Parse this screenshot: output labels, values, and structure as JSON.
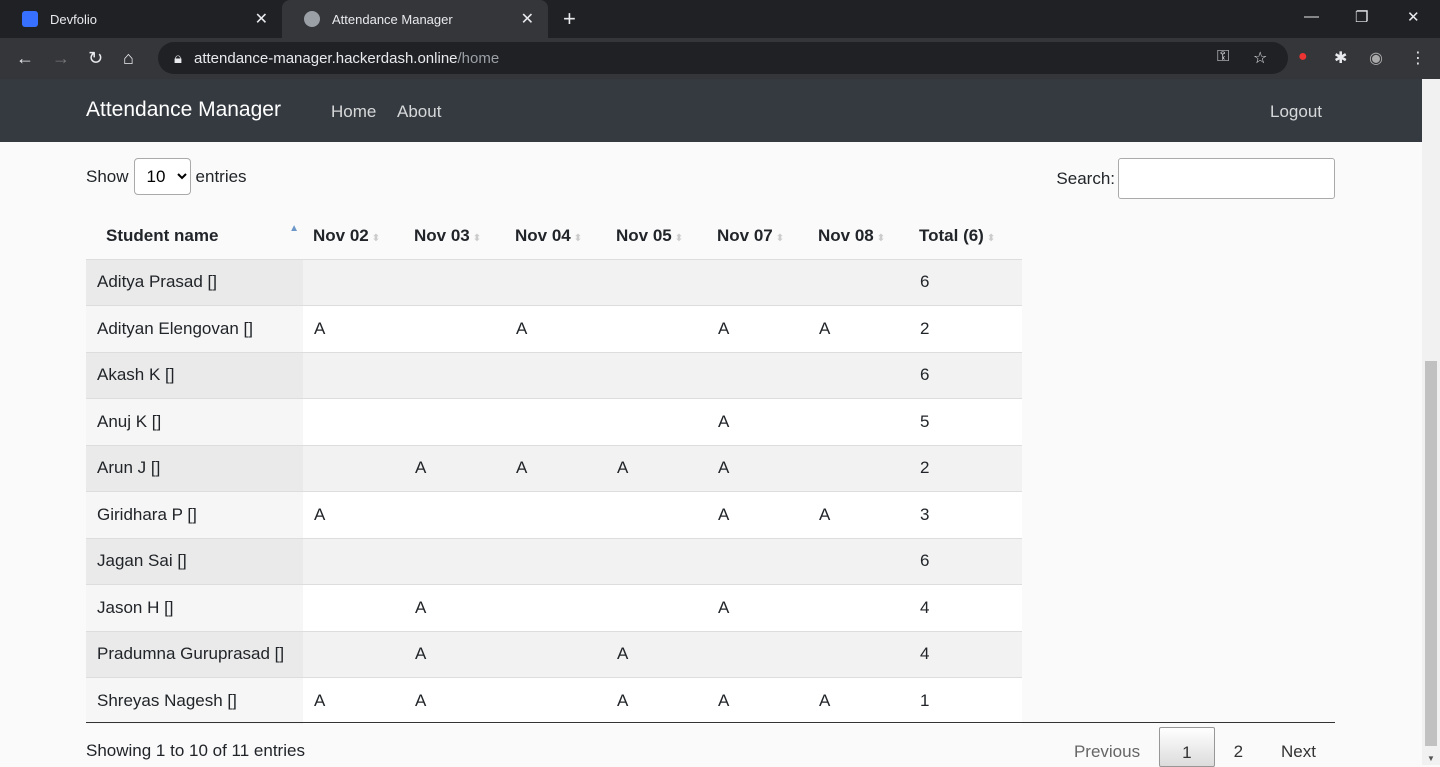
{
  "browser": {
    "tabs": [
      {
        "title": "Devfolio",
        "favicon": "devfolio-logo",
        "favicon_color": "#3770ff"
      },
      {
        "title": "Attendance Manager",
        "favicon": "globe-icon",
        "active": true
      }
    ],
    "url_host": "attendance-manager.hackerdash.online",
    "url_path": "/home"
  },
  "navbar": {
    "brand": "Attendance Manager",
    "links": [
      "Home",
      "About"
    ],
    "logout": "Logout"
  },
  "controls": {
    "show": "Show",
    "entries_value": "10",
    "entries": "entries",
    "search_label": "Search:",
    "search_value": ""
  },
  "table": {
    "headers": [
      "Student name",
      "Nov 02",
      "Nov 03",
      "Nov 04",
      "Nov 05",
      "Nov 07",
      "Nov 08",
      "Total (6)"
    ],
    "sort_column": "Student name",
    "sort_direction": "ascending",
    "rows": [
      [
        "Aditya Prasad []",
        "",
        "",
        "",
        "",
        "",
        "",
        "6"
      ],
      [
        "Adityan Elengovan []",
        "A",
        "",
        "A",
        "",
        "A",
        "A",
        "2"
      ],
      [
        "Akash K []",
        "",
        "",
        "",
        "",
        "",
        "",
        "6"
      ],
      [
        "Anuj K []",
        "",
        "",
        "",
        "",
        "A",
        "",
        "5"
      ],
      [
        "Arun J []",
        "",
        "A",
        "A",
        "A",
        "A",
        "",
        "2"
      ],
      [
        "Giridhara P []",
        "A",
        "",
        "",
        "",
        "A",
        "A",
        "3"
      ],
      [
        "Jagan Sai []",
        "",
        "",
        "",
        "",
        "",
        "",
        "6"
      ],
      [
        "Jason H []",
        "",
        "A",
        "",
        "",
        "A",
        "",
        "4"
      ],
      [
        "Pradumna Guruprasad []",
        "",
        "A",
        "",
        "A",
        "",
        "",
        "4"
      ],
      [
        "Shreyas Nagesh []",
        "A",
        "A",
        "",
        "A",
        "A",
        "A",
        "1"
      ]
    ]
  },
  "footer": {
    "info": "Showing 1 to 10 of 11 entries",
    "previous": "Previous",
    "pages": [
      "1",
      "2"
    ],
    "current_page": "1",
    "next": "Next"
  }
}
